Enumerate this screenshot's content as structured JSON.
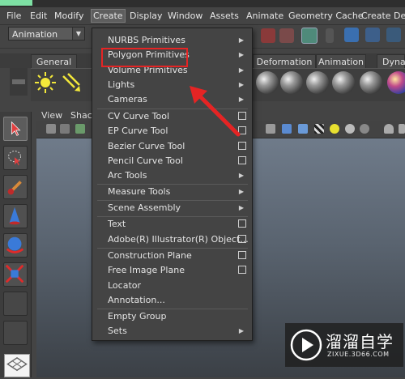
{
  "menubar": {
    "items": [
      "File",
      "Edit",
      "Modify",
      "Create",
      "Display",
      "Window",
      "Assets",
      "Animate",
      "Geometry Cache",
      "Create Defor"
    ],
    "active": "Create"
  },
  "statusline": {
    "mode": "Animation"
  },
  "shelf": {
    "tabs": [
      "General",
      "Deformation",
      "Animation",
      "Dyna"
    ]
  },
  "viewport": {
    "menu": [
      "View",
      "Shac"
    ]
  },
  "create_menu": {
    "items": [
      {
        "label": "NURBS Primitives",
        "submenu": true
      },
      {
        "label": "Polygon Primitives",
        "submenu": true
      },
      {
        "label": "Volume Primitives",
        "submenu": true
      },
      {
        "label": "Lights",
        "submenu": true
      },
      {
        "label": "Cameras",
        "submenu": true
      },
      {
        "label": "CV Curve Tool",
        "option_box": true
      },
      {
        "label": "EP Curve Tool",
        "option_box": true
      },
      {
        "label": "Bezier Curve Tool",
        "option_box": true
      },
      {
        "label": "Pencil Curve Tool",
        "option_box": true
      },
      {
        "label": "Arc Tools",
        "submenu": true
      },
      {
        "label": "Measure Tools",
        "submenu": true
      },
      {
        "label": "Scene Assembly",
        "submenu": true
      },
      {
        "label": "Text",
        "option_box": true
      },
      {
        "label": "Adobe(R) Illustrator(R) Object...",
        "option_box": true
      },
      {
        "label": "Construction Plane",
        "option_box": true
      },
      {
        "label": "Free Image Plane",
        "option_box": true
      },
      {
        "label": "Locator"
      },
      {
        "label": "Annotation..."
      },
      {
        "label": "Empty Group"
      },
      {
        "label": "Sets",
        "submenu": true
      }
    ],
    "highlighted": "Polygon Primitives"
  },
  "watermark": {
    "title": "溜溜自学",
    "url": "ZIXUE.3D66.COM"
  },
  "colors": {
    "annotation": "#e52424",
    "menu_bg": "#444444",
    "viewport_top": "#6f7b8a"
  }
}
